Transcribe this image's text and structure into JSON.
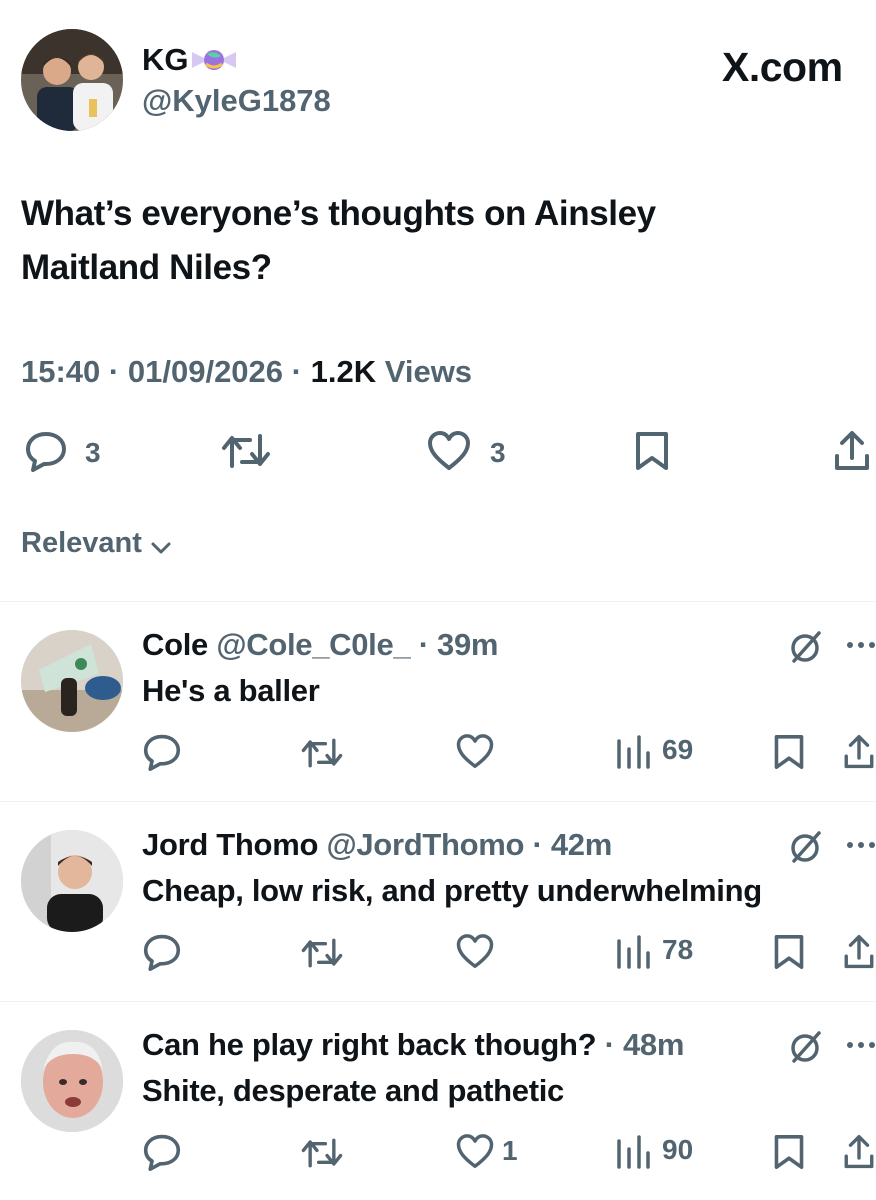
{
  "post": {
    "display_name": "KG",
    "handle": "@KyleG1878",
    "brand": "X.com",
    "text_line1": "What’s everyone’s thoughts on Ainsley",
    "text_line2": "Maitland Niles?",
    "time": "15:40",
    "date": "01/09/2026",
    "views_count": "1.2K",
    "views_label": "Views",
    "sep": "·",
    "reply_count": "3",
    "like_count": "3"
  },
  "sort": {
    "label": "Relevant"
  },
  "replies": [
    {
      "name": "Cole",
      "handle": "@Cole_C0le_",
      "time": "· 39m",
      "text": "He's a baller",
      "likes": "",
      "views": "69"
    },
    {
      "name": "Jord Thomo",
      "handle": "@JordThomo",
      "time": "· 42m",
      "text": "Cheap, low risk, and pretty underwhelming",
      "likes": "",
      "views": "78"
    },
    {
      "name": "Can he play right back though?",
      "handle": "",
      "time": "· 48m",
      "text": "Shite, desperate and pathetic",
      "likes": "1",
      "views": "90"
    }
  ],
  "icons": {
    "reply": "speech-bubble-icon",
    "repost": "repost-arrows-icon",
    "like": "heart-icon",
    "bookmark": "bookmark-icon",
    "share": "share-upload-icon",
    "views": "bar-chart-icon",
    "grok": "slashed-circle-icon",
    "more": "ellipsis-icon",
    "badge": "candy-emoji-icon"
  },
  "colors": {
    "text": "#0f1419",
    "secondary": "#536471",
    "divider": "#eff3f4"
  }
}
